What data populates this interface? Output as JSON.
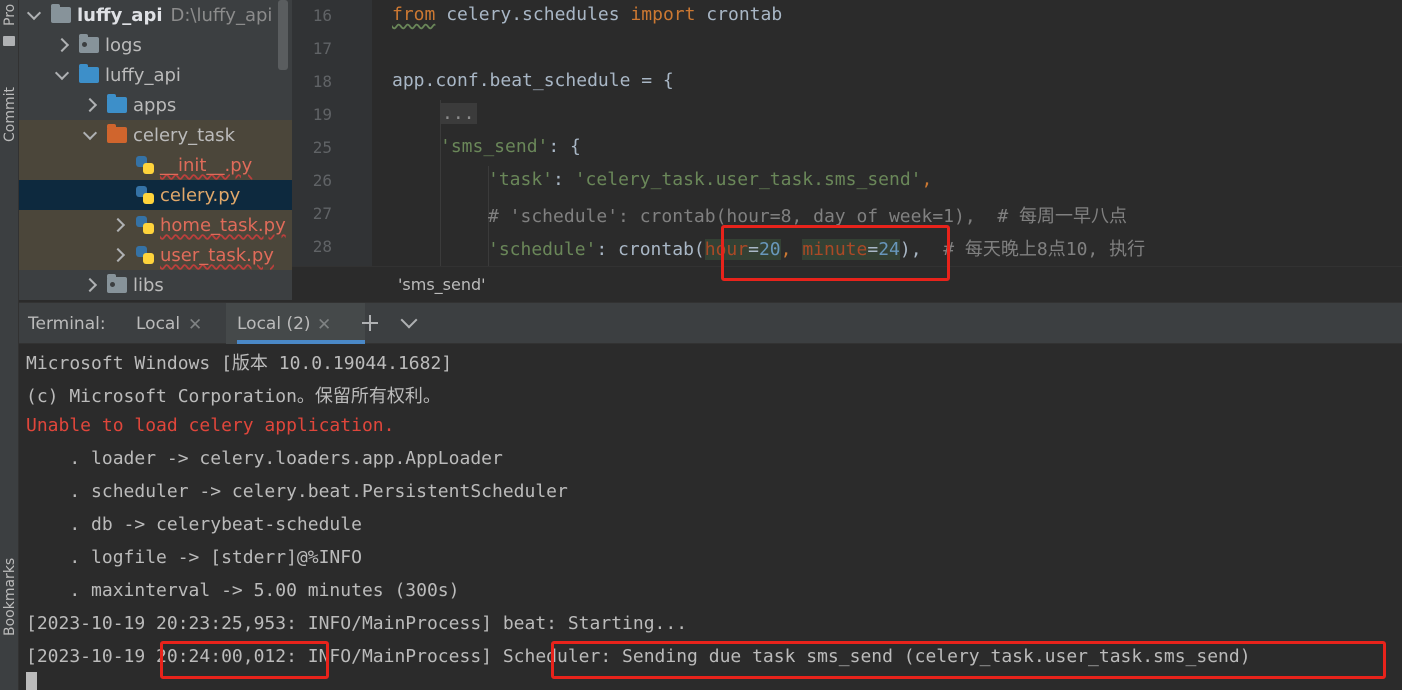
{
  "sidebar_tabs": {
    "project": "Pro",
    "commit": "Commit",
    "bookmarks": "Bookmarks"
  },
  "project_tree": [
    {
      "label": "luffy_api",
      "path": "D:\\luffy_api"
    },
    {
      "label": "logs"
    },
    {
      "label": "luffy_api"
    },
    {
      "label": "apps"
    },
    {
      "label": "celery_task"
    },
    {
      "label": "__init__.py"
    },
    {
      "label": "celery.py"
    },
    {
      "label": "home_task.py"
    },
    {
      "label": "user_task.py"
    },
    {
      "label": "libs"
    }
  ],
  "editor": {
    "lines": [
      {
        "no": "16"
      },
      {
        "no": "17"
      },
      {
        "no": "18"
      },
      {
        "no": "19"
      },
      {
        "no": "25"
      },
      {
        "no": "26"
      },
      {
        "no": "27"
      },
      {
        "no": "28"
      }
    ],
    "code": {
      "l16_kw1": "from",
      "l16_mod": " celery.schedules ",
      "l16_kw2": "import",
      "l16_name": " crontab",
      "l18": "app.conf.beat_schedule = {",
      "l19": "...",
      "l25_key": "'sms_send'",
      "l25_rest": ": {",
      "l26_key": "'task'",
      "l26_sep": ": ",
      "l26_val": "'celery_task.user_task.sms_send'",
      "l26_end": ",",
      "l27": "# 'schedule': crontab(hour=8, day_of_week=1),  # 每周一早八点",
      "l28_key": "'schedule'",
      "l28_sep": ": crontab(",
      "l28_p1": "hour",
      "l28_eq1": "=",
      "l28_v1": "20",
      "l28_comma": ", ",
      "l28_p2": "minute",
      "l28_eq2": "=",
      "l28_v2": "24",
      "l28_close": "),  ",
      "l28_cmt": "# 每天晚上8点10, 执行"
    },
    "breadcrumb": "'sms_send'"
  },
  "terminal": {
    "label": "Terminal:",
    "tabs": [
      {
        "label": "Local"
      },
      {
        "label": "Local (2)"
      }
    ],
    "output": [
      "Microsoft Windows [版本 10.0.19044.1682]",
      "(c) Microsoft Corporation。保留所有权利。",
      "Unable to load celery application.",
      "    . loader -> celery.loaders.app.AppLoader",
      "    . scheduler -> celery.beat.PersistentScheduler",
      "    . db -> celerybeat-schedule",
      "    . logfile -> [stderr]@%INFO",
      "    . maxinterval -> 5.00 minutes (300s)",
      "[2023-10-19 20:23:25,953: INFO/MainProcess] beat: Starting...",
      "[2023-10-19 20:24:00,012: INFO/MainProcess] Scheduler: Sending due task sms_send (celery_task.user_task.sms_send)"
    ]
  },
  "colors": {
    "highlight_box": "#e8231b",
    "error_text": "#e0463b"
  }
}
